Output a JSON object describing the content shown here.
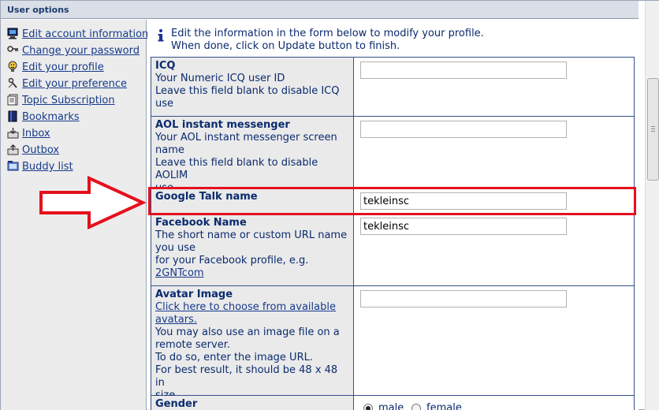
{
  "header": {
    "title": "User options"
  },
  "sidebar": {
    "items": [
      {
        "label": "Edit account information",
        "icon": "monitor-icon"
      },
      {
        "label": "Change your password",
        "icon": "key-icon"
      },
      {
        "label": "Edit your profile",
        "icon": "profile-icon"
      },
      {
        "label": "Edit your preference",
        "icon": "tools-icon"
      },
      {
        "label": "Topic Subscription",
        "icon": "document-icon"
      },
      {
        "label": "Bookmarks",
        "icon": "bookmark-icon"
      },
      {
        "label": "Inbox",
        "icon": "inbox-icon"
      },
      {
        "label": "Outbox",
        "icon": "outbox-icon"
      },
      {
        "label": "Buddy list",
        "icon": "buddy-icon"
      }
    ]
  },
  "info": {
    "icon": "info-icon",
    "line1": "Edit the information in the form below to modify your profile.",
    "line2": "When done, click on Update button to finish."
  },
  "form": {
    "icq": {
      "label": "ICQ",
      "desc1": "Your Numeric ICQ user ID",
      "desc2": "Leave this field blank to disable ICQ",
      "desc3": "use",
      "value": ""
    },
    "aol": {
      "label": "AOL instant messenger",
      "desc1": "Your AOL instant messenger screen",
      "desc2": "name",
      "desc3": "Leave this field blank to disable AOLIM",
      "desc4": "use",
      "value": ""
    },
    "gtalk": {
      "label": "Google Talk name",
      "value": "tekleinsc"
    },
    "facebook": {
      "label": "Facebook Name",
      "desc1": "The short name or custom URL name",
      "desc2": "you use",
      "desc3": "for your Facebook profile, e.g.",
      "link": "2GNTcom",
      "value": "tekleinsc"
    },
    "avatar": {
      "label": "Avatar Image",
      "link1": "Click here to choose from available",
      "link2": "avatars.",
      "desc1": "You may also use an image file on a",
      "desc2": "remote server.",
      "desc3": "To do so, enter the image URL.",
      "desc4": "For best result, it should be 48 x 48 in",
      "desc5": "size.",
      "value": ""
    },
    "gender": {
      "label": "Gender",
      "options": [
        "male",
        "female"
      ],
      "selected": "male"
    }
  },
  "colors": {
    "highlight": "#e5101d",
    "link": "#163a8a",
    "label_bg": "#eaeaea",
    "border": "#34508a"
  }
}
